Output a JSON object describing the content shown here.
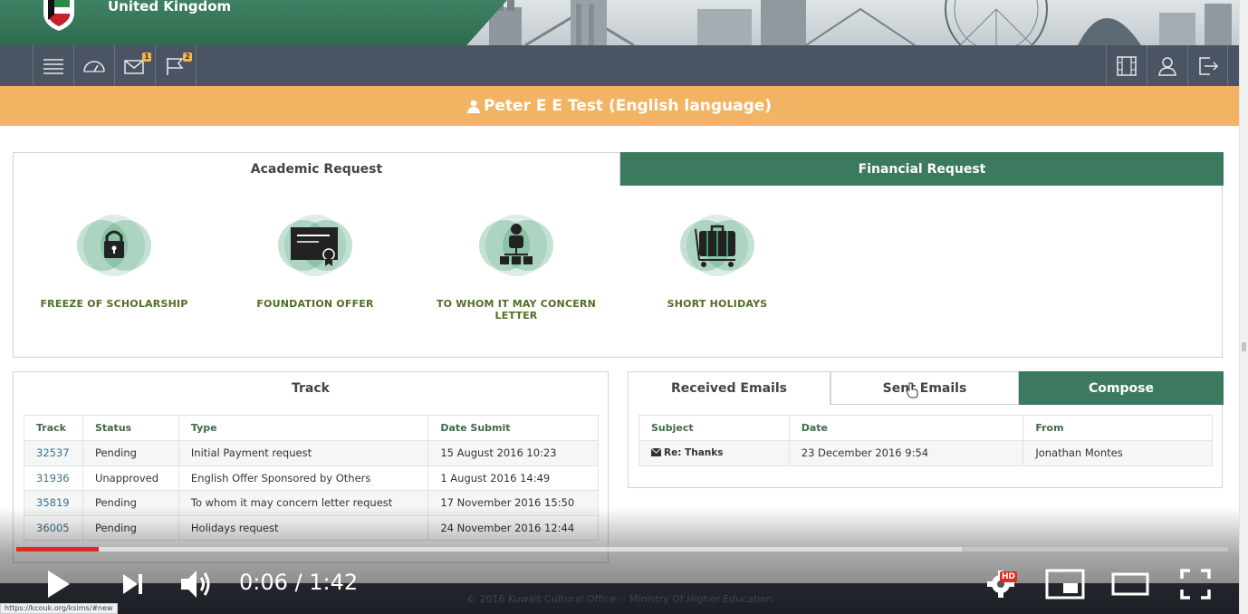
{
  "banner": {
    "country": "United Kingdom"
  },
  "toolbar": {
    "messages_count": "1",
    "flags_count": "2"
  },
  "user": {
    "name": "Peter E E Test (English language)"
  },
  "requests": {
    "tabs": [
      {
        "label": "Academic Request",
        "active": true
      },
      {
        "label": "Financial Request",
        "active": false
      }
    ],
    "items": [
      {
        "label": "FREEZE OF SCHOLARSHIP",
        "icon": "lock-icon"
      },
      {
        "label": "FOUNDATION OFFER",
        "icon": "certificate-icon"
      },
      {
        "label": "TO WHOM IT MAY CONCERN LETTER",
        "icon": "org-chart-icon"
      },
      {
        "label": "SHORT HOLIDAYS",
        "icon": "luggage-icon"
      }
    ]
  },
  "track": {
    "title": "Track",
    "columns": [
      "Track",
      "Status",
      "Type",
      "Date Submit"
    ],
    "rows": [
      [
        "32537",
        "Pending",
        "Initial Payment request",
        "15 August 2016 10:23"
      ],
      [
        "31936",
        "Unapproved",
        "English Offer Sponsored by Others",
        "1 August 2016 14:49"
      ],
      [
        "35819",
        "Pending",
        "To whom it may concern letter request",
        "17 November 2016 15:50"
      ],
      [
        "36005",
        "Pending",
        "Holidays request",
        "24 November 2016 12:44"
      ]
    ]
  },
  "emails": {
    "tabs": [
      {
        "label": "Received Emails",
        "active": true
      },
      {
        "label": "Sent Emails",
        "active": false
      },
      {
        "label": "Compose",
        "active": false
      }
    ],
    "columns": [
      "Subject",
      "Date",
      "From"
    ],
    "rows": [
      {
        "subject": "Re: Thanks",
        "date": "23 December 2016 9:54",
        "from": "Jonathan Montes"
      }
    ]
  },
  "footer": {
    "text": "© 2016 Kuwait Cultural Office -- Ministry Of Higher Education"
  },
  "video": {
    "current_time": "0:06",
    "duration": "1:42",
    "time_display": "0:06 / 1:42",
    "played_fraction": 0.068,
    "buffered_fraction": 0.78,
    "hd_label": "HD",
    "status_url": "https://kcouk.org/ksims/#new"
  },
  "colors": {
    "accent_green": "#3b7a5e",
    "user_bar": "#f2b462",
    "toolbar": "#4b5462",
    "label_green": "#4f6f25",
    "progress_red": "#e02a20"
  }
}
